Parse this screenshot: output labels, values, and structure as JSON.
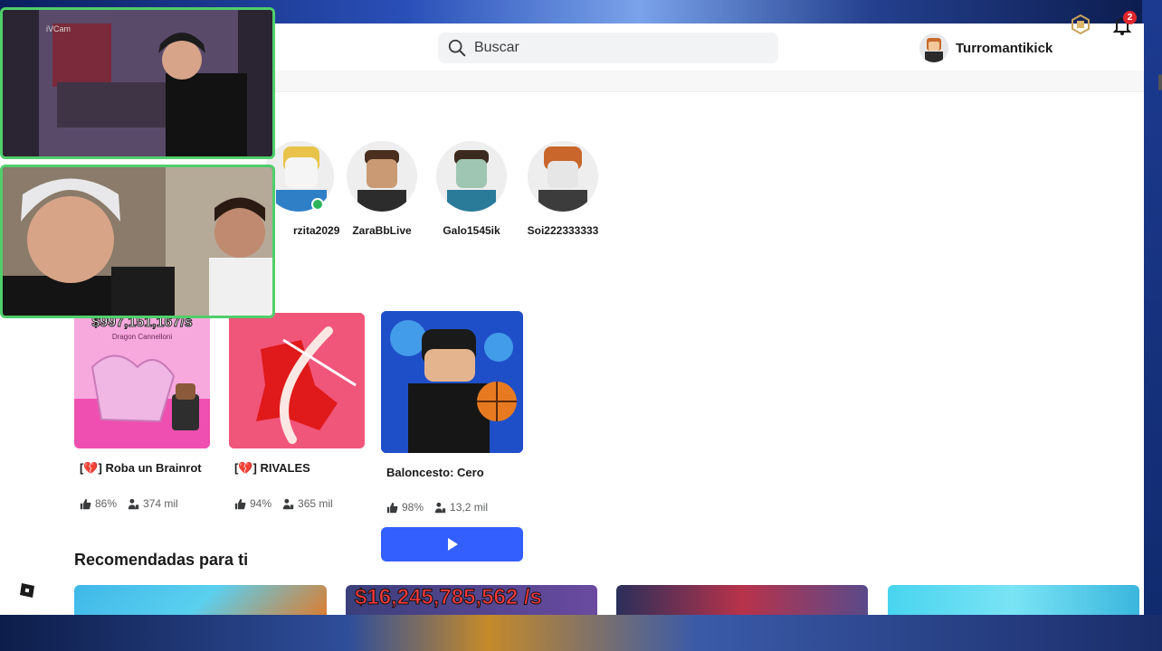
{
  "search": {
    "placeholder": "Buscar"
  },
  "user": {
    "name": "Turromantikick",
    "notifications": "2"
  },
  "friends": [
    {
      "name": "rzita2029",
      "online": true
    },
    {
      "name": "ZaraBbLive",
      "online": false
    },
    {
      "name": "Galo1545ik",
      "online": false
    },
    {
      "name": "Soi222333333",
      "online": false
    }
  ],
  "games": [
    {
      "title": "[💔] Roba un Brainrot",
      "rating": "86%",
      "players": "374 mil",
      "overlay": "$997,151,167/s",
      "overlay_sub": "Dragon Cannelloni"
    },
    {
      "title": "[💔] RIVALES",
      "rating": "94%",
      "players": "365 mil"
    },
    {
      "title": "Baloncesto: Cero",
      "rating": "98%",
      "players": "13,2 mil"
    }
  ],
  "recommended": {
    "title": "Recomendadas para ti",
    "cards": [
      {
        "overlay": ""
      },
      {
        "overlay": "$16,245,785,562 /s"
      },
      {
        "overlay": ""
      },
      {
        "overlay": ""
      }
    ]
  },
  "cams": {
    "label": "iVCam"
  },
  "colors": {
    "play": "#335fff",
    "online": "#2bb55a",
    "cam_border": "#4fcf6a",
    "badge": "#e0262b"
  }
}
